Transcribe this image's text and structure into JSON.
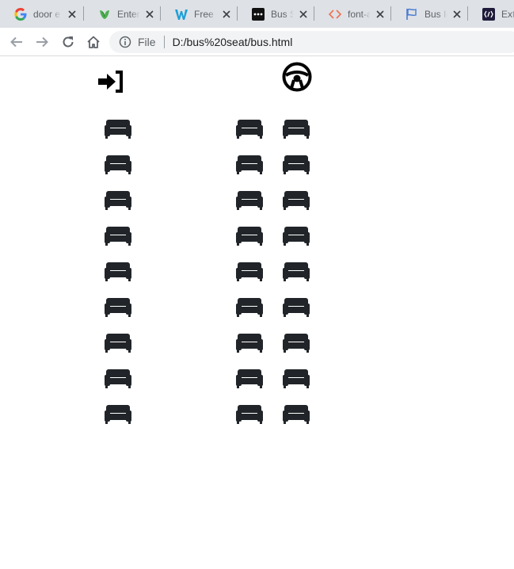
{
  "browser": {
    "tabs": [
      {
        "title": "door e",
        "favicon": "google-icon"
      },
      {
        "title": "Enter t",
        "favicon": "leaf-icon"
      },
      {
        "title": "Free d",
        "favicon": "w-logo-icon"
      },
      {
        "title": "Bus Se",
        "favicon": "dots-icon"
      },
      {
        "title": "font-a",
        "favicon": "code-icon"
      },
      {
        "title": "Bus Ic",
        "favicon": "flag-icon"
      },
      {
        "title": "Exte",
        "favicon": "brackets-icon"
      }
    ],
    "address_bar": {
      "scheme": "File",
      "url": "D:/bus%20seat/bus.html"
    }
  },
  "bus": {
    "door_icon": "sign-in-icon",
    "driver_icon": "steering-wheel-icon",
    "seat_icon": "couch-icon",
    "rows": 9,
    "left_column_seats_per_row": 1,
    "right_column_seats_per_row": 2,
    "seat_color": "#212529"
  }
}
